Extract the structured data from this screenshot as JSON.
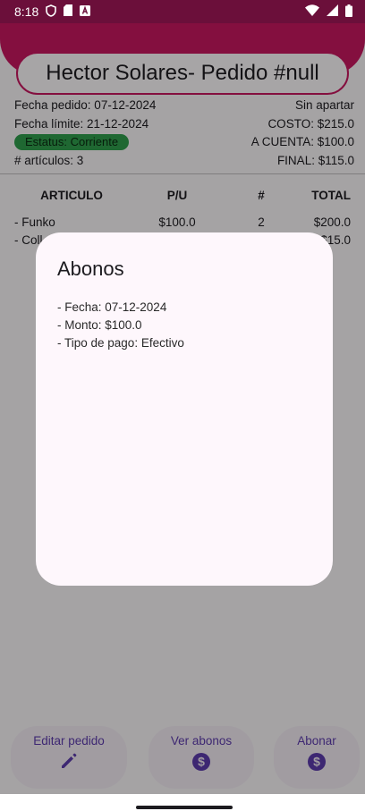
{
  "status_bar": {
    "time": "8:18",
    "icons_left": [
      "shield-icon",
      "sd-card-icon",
      "a-box-icon"
    ],
    "icons_right": [
      "wifi-icon",
      "signal-icon",
      "battery-icon"
    ]
  },
  "header": {
    "title": "Hector Solares- Pedido #null",
    "accent_color": "#c3175d"
  },
  "order_info": {
    "fecha_pedido": "Fecha pedido: 07-12-2024",
    "apartado": "Sin apartar",
    "fecha_limite": "Fecha límite: 21-12-2024",
    "costo": "COSTO: $215.0",
    "estatus": "Estatus: Corriente",
    "a_cuenta": "A CUENTA: $100.0",
    "articulos": "# artículos: 3",
    "final": "FINAL: $115.0"
  },
  "table": {
    "headers": [
      "ARTICULO",
      "P/U",
      "#",
      "TOTAL"
    ],
    "rows": [
      {
        "articulo": "- Funko",
        "pu": "$100.0",
        "cantidad": "2",
        "total": "$200.0"
      },
      {
        "articulo": "- Coll",
        "pu": "",
        "cantidad": "",
        "total": "$15.0"
      }
    ]
  },
  "dialog": {
    "title": "Abonos",
    "lines": [
      "- Fecha: 07-12-2024",
      "- Monto: $100.0",
      "- Tipo de pago: Efectivo"
    ]
  },
  "actions": {
    "editar": {
      "label": "Editar pedido",
      "icon": "pencil-icon"
    },
    "ver_abonos": {
      "label": "Ver abonos",
      "icon": "dollar-circle-icon"
    },
    "abonar": {
      "label": "Abonar",
      "icon": "dollar-circle-icon"
    }
  }
}
